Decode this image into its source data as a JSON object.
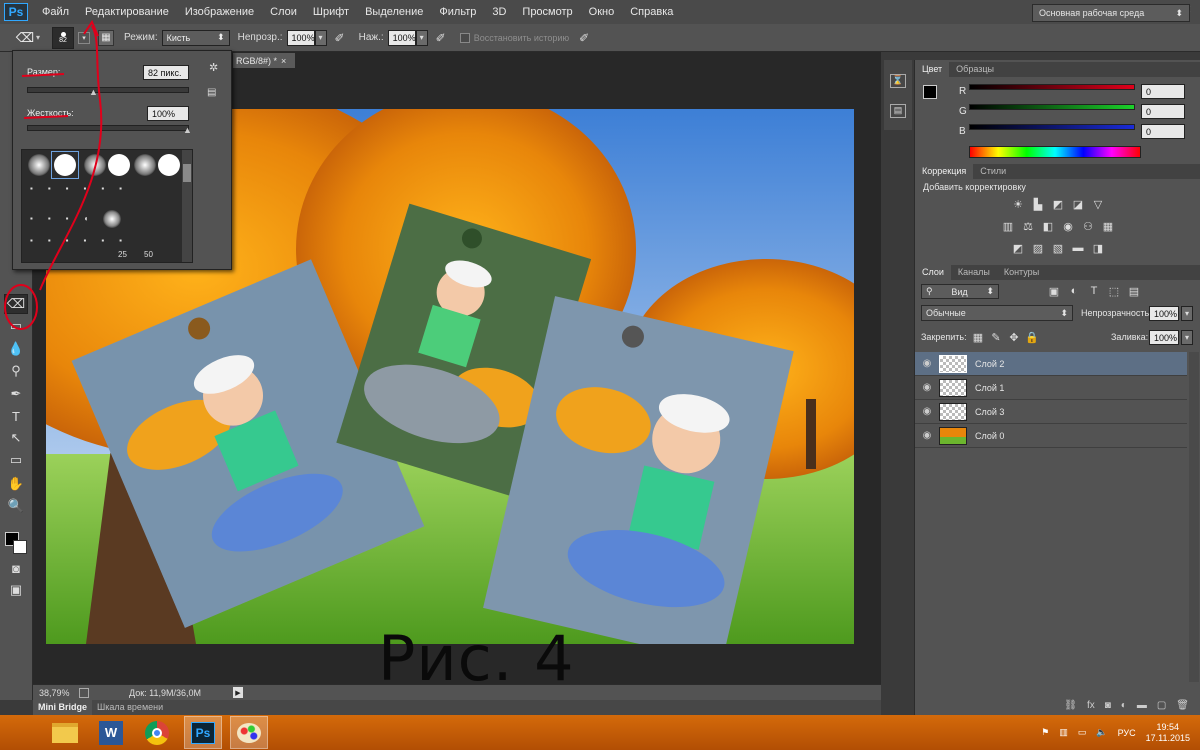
{
  "menu": [
    "Файл",
    "Редактирование",
    "Изображение",
    "Слои",
    "Шрифт",
    "Выделение",
    "Фильтр",
    "3D",
    "Просмотр",
    "Окно",
    "Справка"
  ],
  "app_logo": "Ps",
  "options": {
    "brush_size_value": "82",
    "mode_label": "Режим:",
    "mode_value": "Кисть",
    "opacity_label": "Непрозр.:",
    "opacity_value": "100%",
    "pressure_label": "Наж.:",
    "pressure_value": "100%",
    "restore_history": "Восстановить историю",
    "workspace": "Основная рабочая среда"
  },
  "document_tab": "RGB/8#) *",
  "brush_popup": {
    "size_label": "Размер:",
    "size_value": "82 пикс.",
    "hardness_label": "Жесткость:",
    "hardness_value": "100%",
    "preset_numbers": [
      "25",
      "50"
    ]
  },
  "status": {
    "zoom": "38,79%",
    "doc_info": "Док: 11,9M/36,0M"
  },
  "bottom_tabs": [
    "Mini Bridge",
    "Шкала времени"
  ],
  "color_panel": {
    "tabs": [
      "Цвет",
      "Образцы"
    ],
    "channels": [
      {
        "label": "R",
        "value": "0"
      },
      {
        "label": "G",
        "value": "0"
      },
      {
        "label": "B",
        "value": "0"
      }
    ]
  },
  "adjustments_panel": {
    "tabs": [
      "Коррекция",
      "Стили"
    ],
    "title": "Добавить корректировку"
  },
  "layers_panel": {
    "tabs": [
      "Слои",
      "Каналы",
      "Контуры"
    ],
    "filter": "Вид",
    "blend": "Обычные",
    "opacity_label": "Непрозрачность:",
    "opacity_value": "100%",
    "lock_label": "Закрепить:",
    "fill_label": "Заливка:",
    "fill_value": "100%",
    "layers": [
      "Слой 2",
      "Слой 1",
      "Слой 3",
      "Слой 0"
    ]
  },
  "caption": "Рис. 4",
  "taskbar": {
    "lang": "РУС",
    "time": "19:54",
    "date": "17.11.2015"
  },
  "colors": {
    "accent_red": "#e0001b",
    "selected_layer": "#5d6f85",
    "taskbar": "#c85c06"
  }
}
